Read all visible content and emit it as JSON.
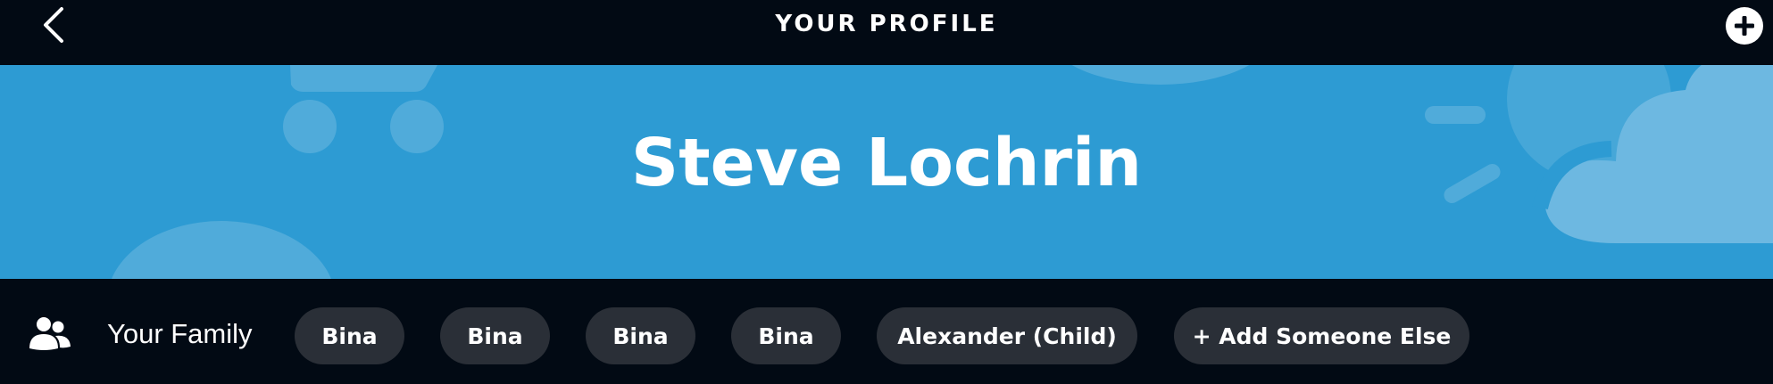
{
  "header": {
    "title": "YOUR PROFILE",
    "back_icon": "chevron-left-icon",
    "add_icon": "plus-circle-icon"
  },
  "banner": {
    "name": "Steve Lochrin",
    "background_color": "#2d9bd3"
  },
  "family": {
    "label": "Your Family",
    "icon": "people-icon",
    "members": [
      {
        "label": "Bina"
      },
      {
        "label": "Bina"
      },
      {
        "label": "Bina"
      },
      {
        "label": "Bina"
      },
      {
        "label": "Alexander (Child)"
      }
    ],
    "add_label": "+ Add Someone Else"
  }
}
